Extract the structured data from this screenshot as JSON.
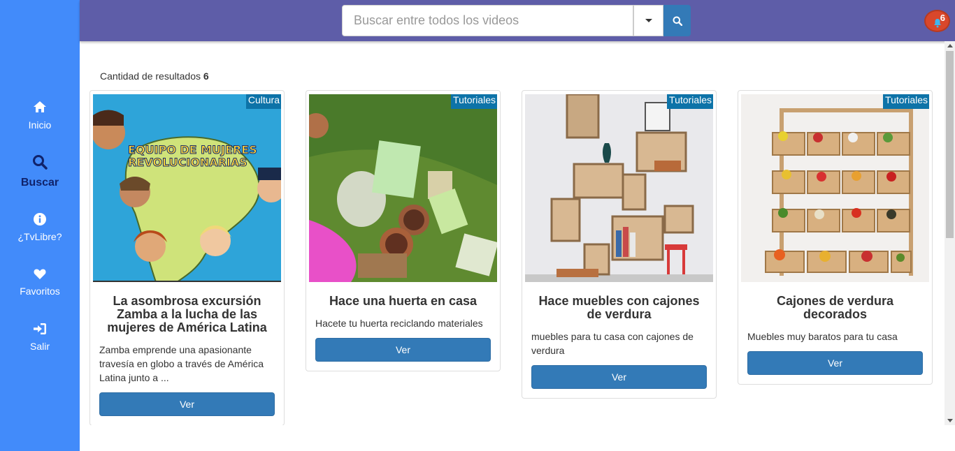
{
  "sidebar": {
    "items": [
      {
        "label": "Inicio",
        "icon": "home-icon"
      },
      {
        "label": "Buscar",
        "icon": "search-icon",
        "active": true
      },
      {
        "label": "¿TvLibre?",
        "icon": "info-icon"
      },
      {
        "label": "Favoritos",
        "icon": "heart-icon"
      },
      {
        "label": "Salir",
        "icon": "sign-in-icon"
      }
    ]
  },
  "header": {
    "search_placeholder": "Buscar entre todos los videos",
    "notification_count": "6"
  },
  "results": {
    "label": "Cantidad de resultados",
    "count": "6"
  },
  "cards": [
    {
      "badge": "Cultura",
      "title": "La asombrosa excursión Zamba a la lucha de las mujeres de América Latina",
      "description": "Zamba emprende una apasionante travesía en globo a través de América Latina junto a ...",
      "button": "Ver"
    },
    {
      "badge": "Tutoriales",
      "title": "Hace una huerta en casa",
      "description": "Hacete tu huerta reciclando materiales",
      "button": "Ver"
    },
    {
      "badge": "Tutoriales",
      "title": "Hace muebles con cajones de verdura",
      "description": "muebles para tu casa con cajones de verdura",
      "button": "Ver"
    },
    {
      "badge": "Tutoriales",
      "title": "Cajones de verdura decorados",
      "description": "Muebles muy baratos para tu casa",
      "button": "Ver"
    }
  ],
  "colors": {
    "sidebar": "#428bfa",
    "header": "#5e5da8",
    "primary_button": "#337ab7",
    "badge": "#0d73a8",
    "active_nav": "#10236b"
  }
}
